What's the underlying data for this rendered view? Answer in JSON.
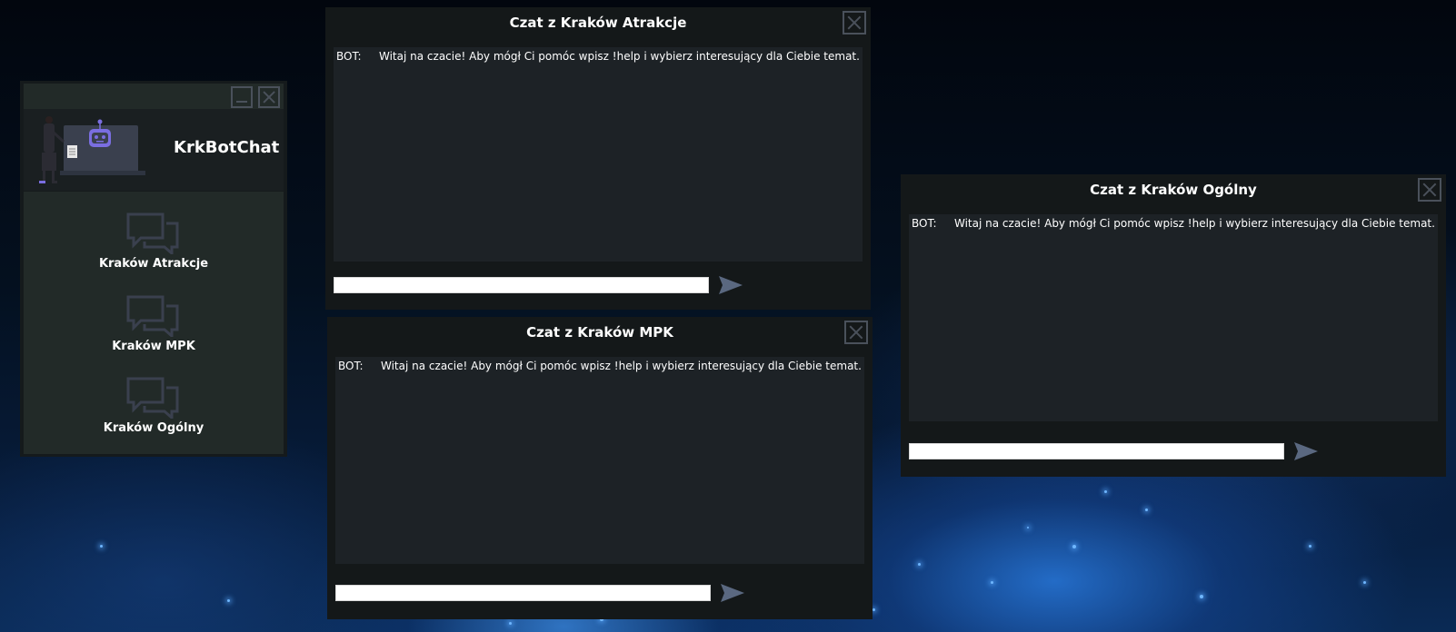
{
  "app": {
    "title": "KrkBotChat"
  },
  "menu": {
    "items": [
      {
        "label": "Kraków Atrakcje",
        "icon": "chat-bubbles-icon"
      },
      {
        "label": "Kraków MPK",
        "icon": "chat-bubbles-icon"
      },
      {
        "label": "Kraków Ogólny",
        "icon": "chat-bubbles-icon"
      }
    ]
  },
  "chats": {
    "atrakcje": {
      "title": "Czat z Kraków Atrakcje",
      "sender": "BOT:",
      "message": "Witaj na czacie! Aby mógł Ci pomóc wpisz !help i wybierz interesujący dla Ciebie temat.",
      "input_value": ""
    },
    "mpk": {
      "title": "Czat z Kraków MPK",
      "sender": "BOT:",
      "message": "Witaj na czacie! Aby mógł Ci pomóc wpisz !help i wybierz interesujący dla Ciebie temat.",
      "input_value": ""
    },
    "ogolny": {
      "title": "Czat z Kraków Ogólny",
      "sender": "BOT:",
      "message": "Witaj na czacie! Aby mógł Ci pomóc wpisz !help i wybierz interesujący dla Ciebie temat.",
      "input_value": ""
    }
  },
  "colors": {
    "window_bg": "#141819",
    "log_bg": "#1d2226",
    "menu_bg": "#222a28",
    "icon": "#3a404e",
    "send_arrow": "#5a6880",
    "robot_accent": "#7a6ee0"
  }
}
